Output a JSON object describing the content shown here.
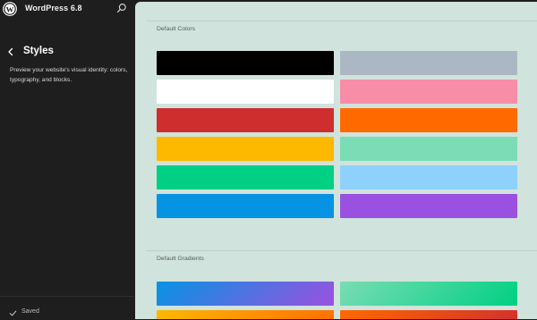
{
  "app": {
    "title": "WordPress 6.8"
  },
  "icons": {
    "logo": "wordpress-logo",
    "search": "search-icon",
    "back": "chevron-left-icon",
    "saved": "check-icon"
  },
  "panel": {
    "title": "Styles",
    "description": "Preview your website's visual identity: colors, typography, and blocks."
  },
  "footer": {
    "status": "Saved"
  },
  "canvas": {
    "background": "#d0e3dc",
    "colors_label": "Default Colors",
    "gradients_label": "Default Gradients",
    "colors": [
      {
        "hex": "#000000"
      },
      {
        "hex": "#abb8c3"
      },
      {
        "hex": "#ffffff"
      },
      {
        "hex": "#f78da7"
      },
      {
        "hex": "#cf2e2e"
      },
      {
        "hex": "#ff6900"
      },
      {
        "hex": "#fcb900"
      },
      {
        "hex": "#7bdcb5"
      },
      {
        "hex": "#00d084"
      },
      {
        "hex": "#8ed1fc"
      },
      {
        "hex": "#0693e3"
      },
      {
        "hex": "#9b51e0"
      }
    ],
    "gradients": [
      {
        "css": "linear-gradient(135deg, #0693e3 0%, #9b51e0 100%)"
      },
      {
        "css": "linear-gradient(135deg, #7adcb4 0%, #00d082 100%)"
      },
      {
        "css": "linear-gradient(135deg, #fcb900 0%, #ff6900 100%)"
      },
      {
        "css": "linear-gradient(135deg, #ff6900 0%, #cf2e2e 100%)"
      }
    ]
  }
}
